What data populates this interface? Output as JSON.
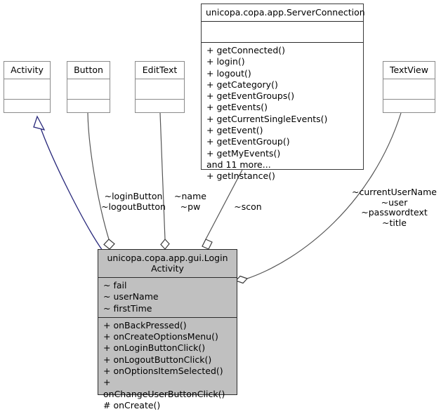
{
  "diagram": {
    "kind": "uml-class-diagram",
    "background_color": "#ffffff",
    "inheritance_arrow_color": "#27277a",
    "association_line_color": "#555555",
    "highlight_fill": "#c0c0c0"
  },
  "classes": {
    "activity": {
      "name": "Activity",
      "attributes": "",
      "operations": ""
    },
    "button": {
      "name": "Button",
      "attributes": "",
      "operations": ""
    },
    "edittext": {
      "name": "EditText",
      "attributes": "",
      "operations": ""
    },
    "textview": {
      "name": "TextView",
      "attributes": "",
      "operations": ""
    },
    "serverconnection": {
      "name": "unicopa.copa.app.ServerConnection",
      "attributes": "",
      "operations": "+ getConnected()\n+ login()\n+ logout()\n+ getCategory()\n+ getEventGroups()\n+ getEvents()\n+ getCurrentSingleEvents()\n+ getEvent()\n+ getEventGroup()\n+ getMyEvents()\nand 11 more...\n+ getInstance()"
    },
    "loginactivity": {
      "name": "unicopa.copa.app.gui.Login\nActivity",
      "attributes": "~ fail\n~ userName\n~ firstTime",
      "operations": "+ onBackPressed()\n+ onCreateOptionsMenu()\n+ onLoginButtonClick()\n+ onLogoutButtonClick()\n+ onOptionsItemSelected()\n+ onChangeUserButtonClick()\n# onCreate()"
    }
  },
  "relations": {
    "activity_inheritance": {
      "from": "loginactivity",
      "to": "activity",
      "type": "generalization",
      "label": ""
    },
    "button_aggregation": {
      "from": "loginactivity",
      "to": "button",
      "type": "aggregation",
      "label": "~loginButton\n~logoutButton"
    },
    "edittext_aggregation": {
      "from": "loginactivity",
      "to": "edittext",
      "type": "aggregation",
      "label": "~name\n~pw"
    },
    "serverconnection_aggregation": {
      "from": "loginactivity",
      "to": "serverconnection",
      "type": "aggregation",
      "label": "~scon"
    },
    "textview_aggregation": {
      "from": "loginactivity",
      "to": "textview",
      "type": "aggregation",
      "label": "~currentUserName\n~user\n~passwordtext\n~title"
    }
  }
}
